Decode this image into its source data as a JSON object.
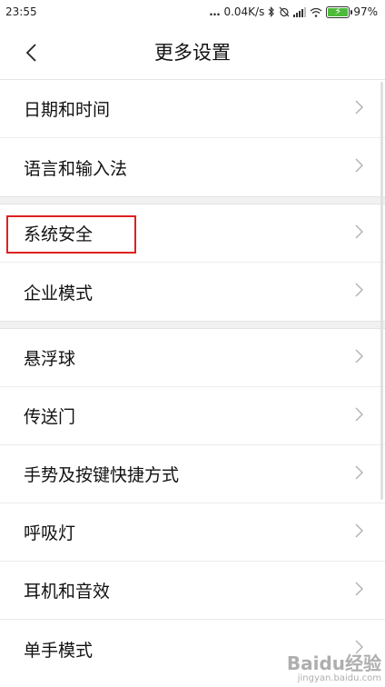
{
  "status_bar": {
    "time": "23:55",
    "dots": "…",
    "speed": "0.04K/s",
    "battery_percent": "97%",
    "battery_level": 0.97,
    "battery_color": "#4cbb3a"
  },
  "header": {
    "title": "更多设置"
  },
  "groups": [
    {
      "items": [
        {
          "label": "日期和时间"
        },
        {
          "label": "语言和输入法"
        }
      ]
    },
    {
      "items": [
        {
          "label": "系统安全"
        },
        {
          "label": "企业模式"
        }
      ]
    },
    {
      "items": [
        {
          "label": "悬浮球"
        },
        {
          "label": "传送门"
        },
        {
          "label": "手势及按键快捷方式"
        },
        {
          "label": "呼吸灯"
        },
        {
          "label": "耳机和音效"
        },
        {
          "label": "单手模式"
        }
      ]
    }
  ],
  "highlight_color": "#e02020",
  "watermark": {
    "text": "Baidu经验",
    "sub": "jingyan.baidu.com"
  }
}
